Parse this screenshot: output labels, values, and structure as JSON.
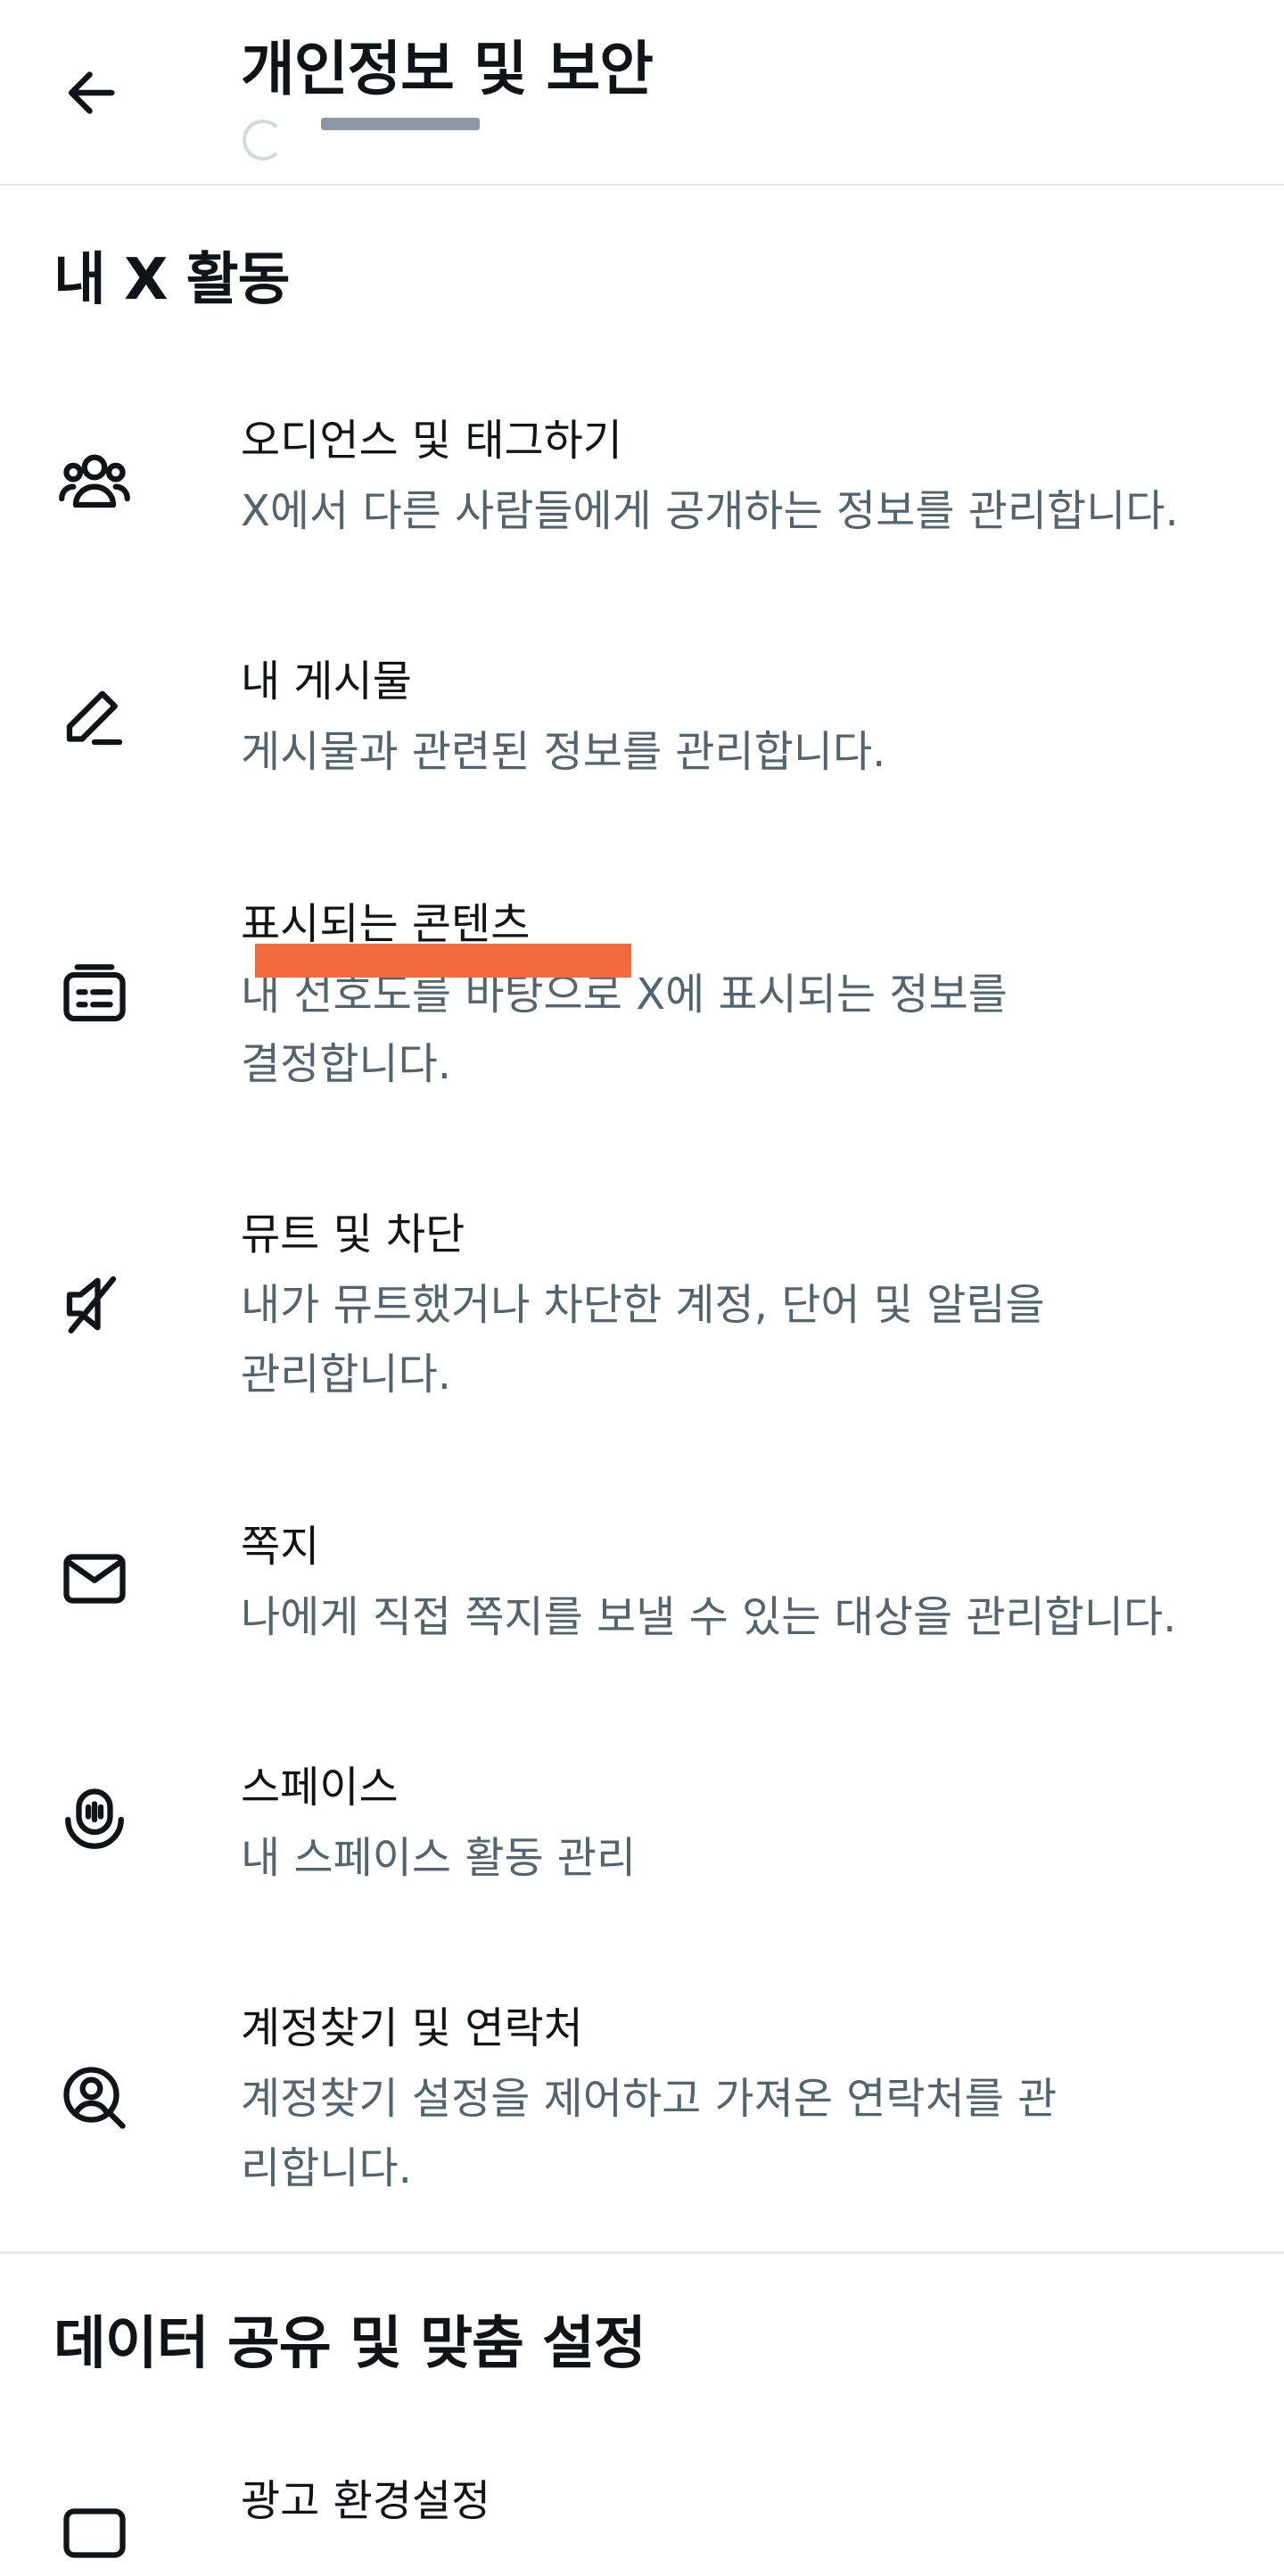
{
  "header": {
    "title": "개인정보 및 보안",
    "back_icon": "arrow-left-icon"
  },
  "sections": [
    {
      "title": "내 X 활동",
      "items": [
        {
          "icon": "people-icon",
          "title": "오디언스 및 태그하기",
          "description": "X에서 다른 사람들에게 공개하는 정보를 관리합니다."
        },
        {
          "icon": "pencil-icon",
          "title": "내 게시물",
          "description": "게시물과 관련된 정보를 관리합니다."
        },
        {
          "icon": "content-card-icon",
          "title": "표시되는 콘텐츠",
          "description": "내 선호도를 바탕으로 X에 표시되는 정보를 결정합니다."
        },
        {
          "icon": "mute-speaker-icon",
          "title": "뮤트 및 차단",
          "description": "내가 뮤트했거나 차단한 계정, 단어 및 알림을 관리합니다."
        },
        {
          "icon": "envelope-icon",
          "title": "쪽지",
          "description": "나에게 직접 쪽지를 보낼 수 있는 대상을 관리합니다."
        },
        {
          "icon": "spaces-mic-icon",
          "title": "스페이스",
          "description": "내 스페이스 활동 관리"
        },
        {
          "icon": "find-account-icon",
          "title": "계정찾기 및 연락처",
          "description": "계정찾기 설정을 제어하고 가져온 연락처를 관리합니다."
        }
      ]
    },
    {
      "title": "데이터 공유 및 맞춤 설정",
      "items": [
        {
          "icon": "ad-card-icon",
          "title": "광고 환경설정",
          "description": ""
        }
      ]
    }
  ],
  "colors": {
    "primary_text": "#0f1419",
    "secondary_text": "#536471",
    "divider": "#e6e9ec",
    "highlight": "#f26a3d"
  }
}
